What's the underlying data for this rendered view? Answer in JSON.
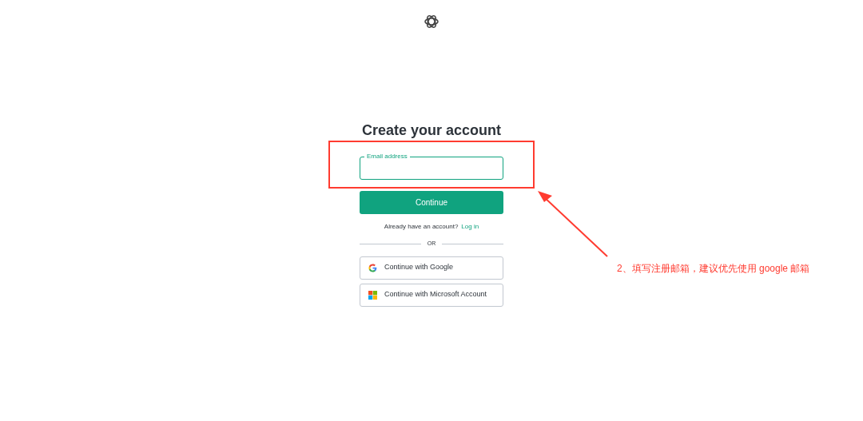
{
  "heading": "Create your account",
  "email_field": {
    "label": "Email address",
    "focused": true
  },
  "continue_button": "Continue",
  "login_prompt": {
    "text": "Already have an account?",
    "link": "Log in"
  },
  "divider": "OR",
  "social_buttons": [
    {
      "kind": "google",
      "label": "Continue with Google"
    },
    {
      "kind": "microsoft",
      "label": "Continue with Microsoft Account"
    }
  ],
  "annotation": {
    "text": "2、填写注册邮箱，建议优先使用 google 邮箱"
  }
}
